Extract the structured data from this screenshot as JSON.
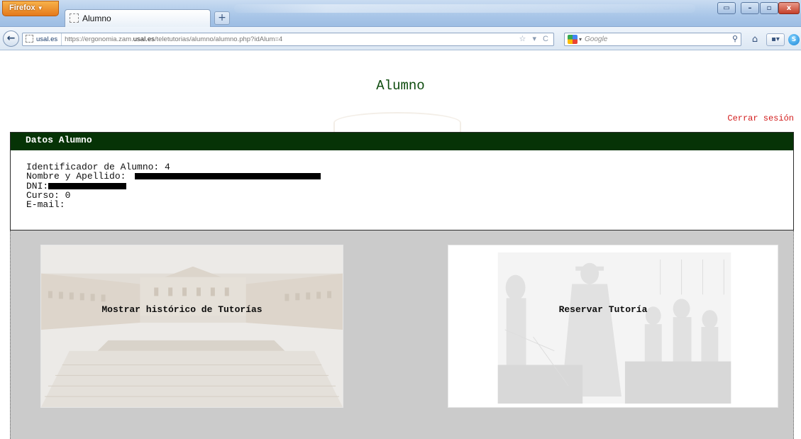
{
  "browser": {
    "menu_label": "Firefox",
    "tab_title": "Alumno",
    "new_tab": "+",
    "back": "←",
    "site_identity": "usal.es",
    "url_prefix": "https://ergonomia.zam.",
    "url_host": "usal.es",
    "url_suffix": "/teletutorias/alumno/alumno.php?idAlum=4",
    "url_icons": "☆ ▾ C",
    "search_placeholder": "Google",
    "search_go": "⚲",
    "home": "⌂",
    "bookmarks": "▪▾",
    "skype": "S",
    "window_buttons": [
      "▭",
      "–",
      "▫",
      "x"
    ]
  },
  "page": {
    "title": "Alumno",
    "logout_label": "Cerrar sesión"
  },
  "student": {
    "section_title": "Datos Alumno",
    "id_label": "Identificador de Alumno: 4",
    "name_label": "Nombre y Apellido: ",
    "dni_label": "DNI:",
    "course_label": "Curso: 0",
    "email_label": "E-mail:"
  },
  "actions": {
    "history_label": "Mostrar histórico de Tutorías",
    "reserve_label": "Reservar Tutoría"
  },
  "colors": {
    "header_green": "#063306",
    "title_green": "#0c4a0c",
    "logout_red": "#d21a1a",
    "panel_gray": "#cbcbcb"
  }
}
